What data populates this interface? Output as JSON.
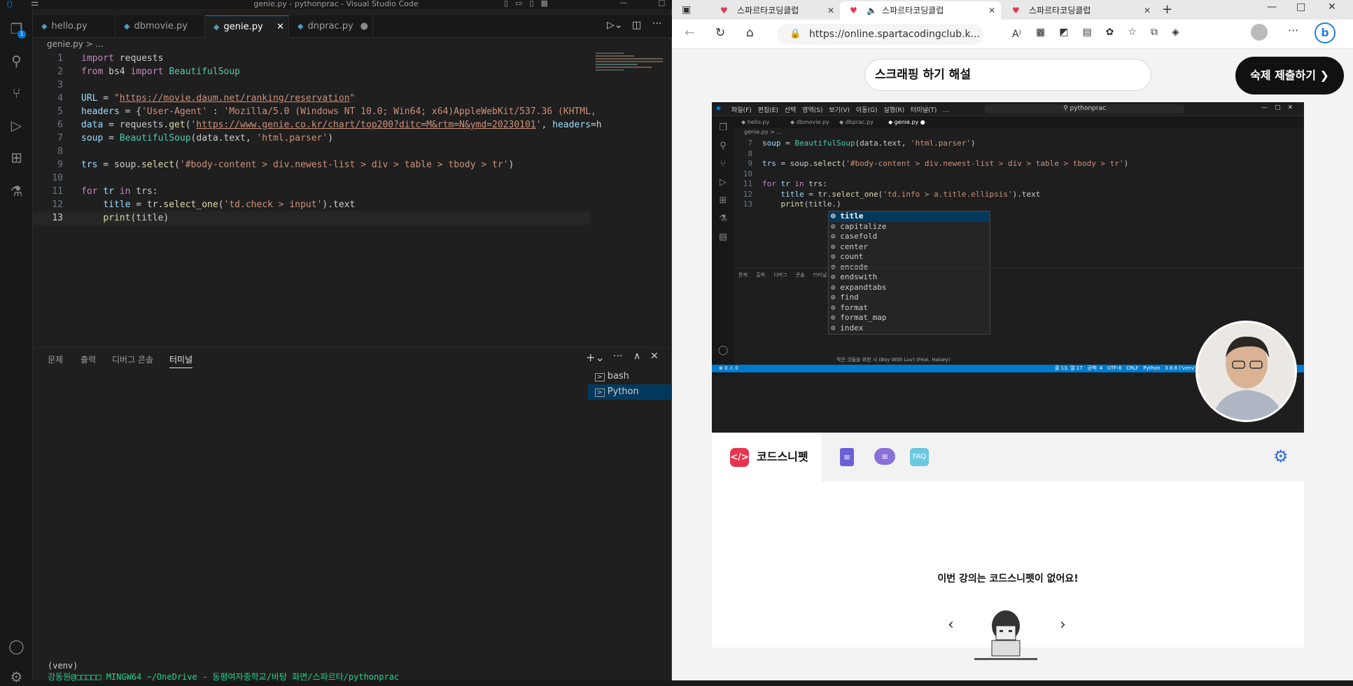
{
  "vscode": {
    "window_title": "genie.py - pythonprac - Visual Studio Code",
    "tabs": [
      {
        "label": "hello.py",
        "active": false,
        "modified": false
      },
      {
        "label": "dbmovie.py",
        "active": false,
        "modified": false
      },
      {
        "label": "genie.py",
        "active": true,
        "modified": false
      },
      {
        "label": "dnprac.py",
        "active": false,
        "modified": true
      }
    ],
    "breadcrumb": "genie.py > ...",
    "code_lines": [
      {
        "n": "1",
        "html": "<span class='kw'>import</span> requests"
      },
      {
        "n": "2",
        "html": "<span class='kw'>from</span> bs4 <span class='kw'>import</span> <span class='cl'>BeautifulSoup</span>"
      },
      {
        "n": "3",
        "html": ""
      },
      {
        "n": "4",
        "html": "<span class='vr'>URL</span> = <span class='st'>\"<u>https://movie.daum.net/ranking/reservation</u>\"</span>"
      },
      {
        "n": "5",
        "html": "<span class='vr'>headers</span> = {<span class='st'>'User-Agent'</span> : <span class='st'>'Mozilla/5.0 (Windows NT 10.0; Win64; x64)AppleWebKit/537.36 (KHTML,</span>"
      },
      {
        "n": "6",
        "html": "<span class='vr'>data</span> = requests.<span class='fn'>get</span>(<span class='st'>'<u>https://www.genie.co.kr/chart/top200?ditc=M&amp;rtm=N&amp;ymd=20230101</u>'</span>, <span class='vr'>headers</span>=h"
      },
      {
        "n": "7",
        "html": "<span class='vr'>soup</span> = <span class='cl'>BeautifulSoup</span>(data.text, <span class='st'>'html.parser'</span>)"
      },
      {
        "n": "8",
        "html": ""
      },
      {
        "n": "9",
        "html": "<span class='vr'>trs</span> = soup.<span class='fn'>select</span>(<span class='st'>'#body-content &gt; div.newest-list &gt; div &gt; table &gt; tbody &gt; tr'</span>)"
      },
      {
        "n": "10",
        "html": ""
      },
      {
        "n": "11",
        "html": "<span class='kw'>for</span> <span class='vr'>tr</span> <span class='kw'>in</span> trs:"
      },
      {
        "n": "12",
        "html": "    <span class='vr'>title</span> = tr.<span class='fn'>select_one</span>(<span class='st'>'td.check &gt; input'</span>).text"
      },
      {
        "n": "13",
        "html": "    <span class='fn'>print</span>(title)"
      }
    ],
    "panel_tabs": [
      "문제",
      "출력",
      "디버그 콘솔",
      "터미널"
    ],
    "terminals": [
      "bash",
      "Python"
    ],
    "terminal_lines": [
      "(venv)",
      "강동원@□□□□□ MINGW64 ~/OneDrive - 동평여자중학교/바탕 화면/스파르타/pythonprac"
    ]
  },
  "browser": {
    "tabs": [
      {
        "label": "스파르타코딩클럽",
        "active": false
      },
      {
        "label": "스파르타코딩클럽",
        "active": true
      },
      {
        "label": "스파르타코딩클럽",
        "active": false
      }
    ],
    "url": "https://online.spartacodingclub.k...",
    "lecture_title": "스크래핑 하기 해설",
    "submit_label": "숙제 제출하기",
    "snippet_tab": "코드스니펫",
    "faq_label": "FAQ",
    "empty_message": "이번 강의는 코드스니펫이 없어요!",
    "video": {
      "menu": [
        "파일(F)",
        "편집(E)",
        "선택 영역(S)",
        "보기(V)",
        "이동(G)",
        "실행(R)",
        "터미널(T)",
        "..."
      ],
      "search": "pythonprac",
      "tabs": [
        "hello.py",
        "dbmovie.py",
        "dbprac.py",
        "genie.py"
      ],
      "breadcrumb": "genie.py > ...",
      "lines": [
        {
          "n": "7",
          "html": "<span class='vr'>soup</span> = <span class='cl'>BeautifulSoup</span>(data.text, <span class='st'>'html.parser'</span>)"
        },
        {
          "n": "8",
          "html": ""
        },
        {
          "n": "9",
          "html": "<span class='vr'>trs</span> = soup.<span class='fn'>select</span>(<span class='st'>'#body-content &gt; div.newest-list &gt; div &gt; table &gt; tbody &gt; tr'</span>)"
        },
        {
          "n": "10",
          "html": ""
        },
        {
          "n": "11",
          "html": "<span class='kw'>for</span> <span class='vr'>tr</span> <span class='kw'>in</span> trs:"
        },
        {
          "n": "12",
          "html": "    <span class='vr'>title</span> = tr.<span class='fn'>select_one</span>(<span class='st'>'td.info &gt; a.title.ellipsis'</span>).text"
        },
        {
          "n": "13",
          "html": "    <span class='fn'>print</span>(title.)"
        }
      ],
      "autocomplete": [
        "title",
        "capitalize",
        "casefold",
        "center",
        "count",
        "encode",
        "endswith",
        "expandtabs",
        "find",
        "format",
        "format_map",
        "index"
      ],
      "panel_tabs": [
        "문제",
        "출력",
        "디버그 콘솔",
        "터미널"
      ],
      "status_left": "⊗ 0 ⚠ 0",
      "status_right": "줄 13, 열 17   공백: 4   UTF-8   CRLF   Python   3.8.6 ('venv': venv)   Go Live",
      "now_playing": "작은 것들을 위한 시 (Boy With Luv) (Feat. Halsey)"
    }
  }
}
